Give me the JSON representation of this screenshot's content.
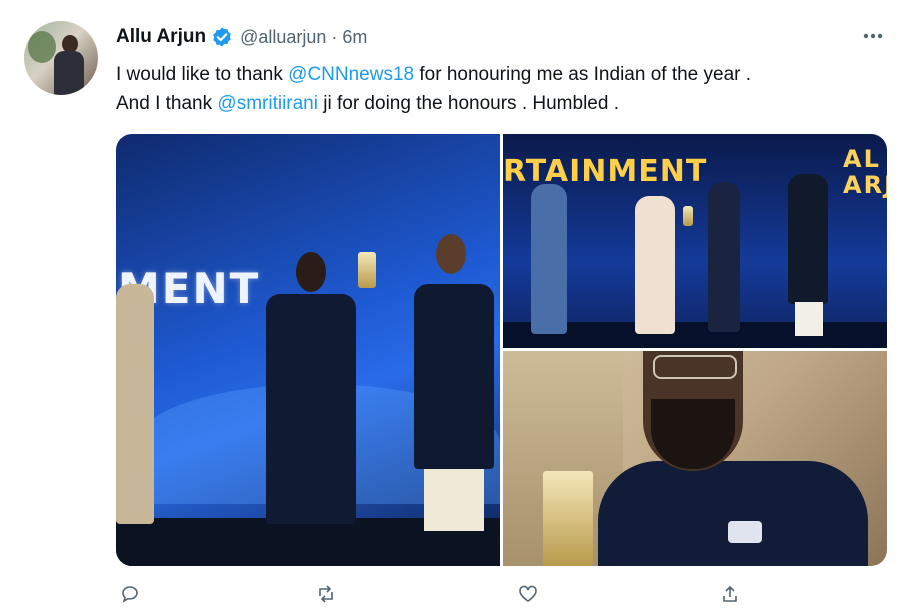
{
  "tweet": {
    "author_name": "Allu Arjun",
    "handle": "@alluarjun",
    "separator": "·",
    "time": "6m",
    "text_line1_pre": "I would like to thank ",
    "mention1": "@CNNnews18",
    "text_line1_post": " for honouring me as Indian of the year .",
    "text_line2_pre": "And I thank ",
    "mention2": "@smritiirani",
    "text_line2_post": " ji for doing the honours . Humbled ."
  },
  "media": {
    "image1_stage_text": "MENT",
    "image2_stage_text": "RTAINMENT",
    "image2_stage_text_right": "AL\nARJ"
  },
  "icons": {
    "verified": "verified-badge-icon",
    "more": "more-options-icon",
    "reply": "reply-icon",
    "retweet": "retweet-icon",
    "like": "like-icon",
    "share": "share-icon"
  },
  "colors": {
    "link": "#1d9bf0",
    "secondary_text": "#536471",
    "primary_text": "#0f1419"
  }
}
